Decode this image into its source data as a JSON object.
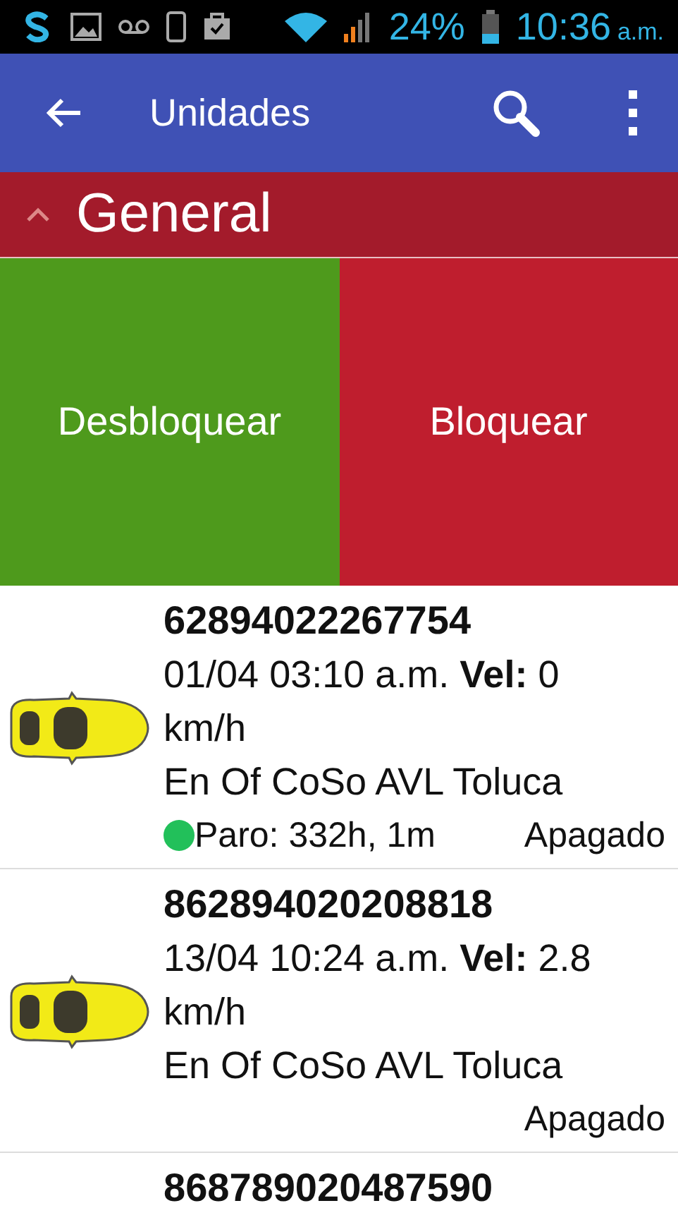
{
  "status_bar": {
    "battery": "24%",
    "time": "10:36",
    "time_suffix": "a.m."
  },
  "app_bar": {
    "title": "Unidades"
  },
  "group": {
    "title": "General",
    "expanded": true
  },
  "actions": [
    {
      "label": "Desbloquear",
      "kind": "unlock"
    },
    {
      "label": "Bloquear",
      "kind": "lock"
    }
  ],
  "units": [
    {
      "id": "62894022267754",
      "info": "01/04 03:10 a.m. **Vel:** 0 km/h",
      "location": "En Of CoSo AVL Toluca",
      "stop": {
        "text": "Paro: 332h, 1m",
        "color": "#22c05a"
      },
      "state": "Apagado"
    },
    {
      "id": "862894020208818",
      "info": "13/04 10:24 a.m. **Vel:** 2.8 km/h",
      "location": "En Of CoSo AVL Toluca",
      "state": "Apagado"
    },
    {
      "id": "868789020487590"
    }
  ]
}
